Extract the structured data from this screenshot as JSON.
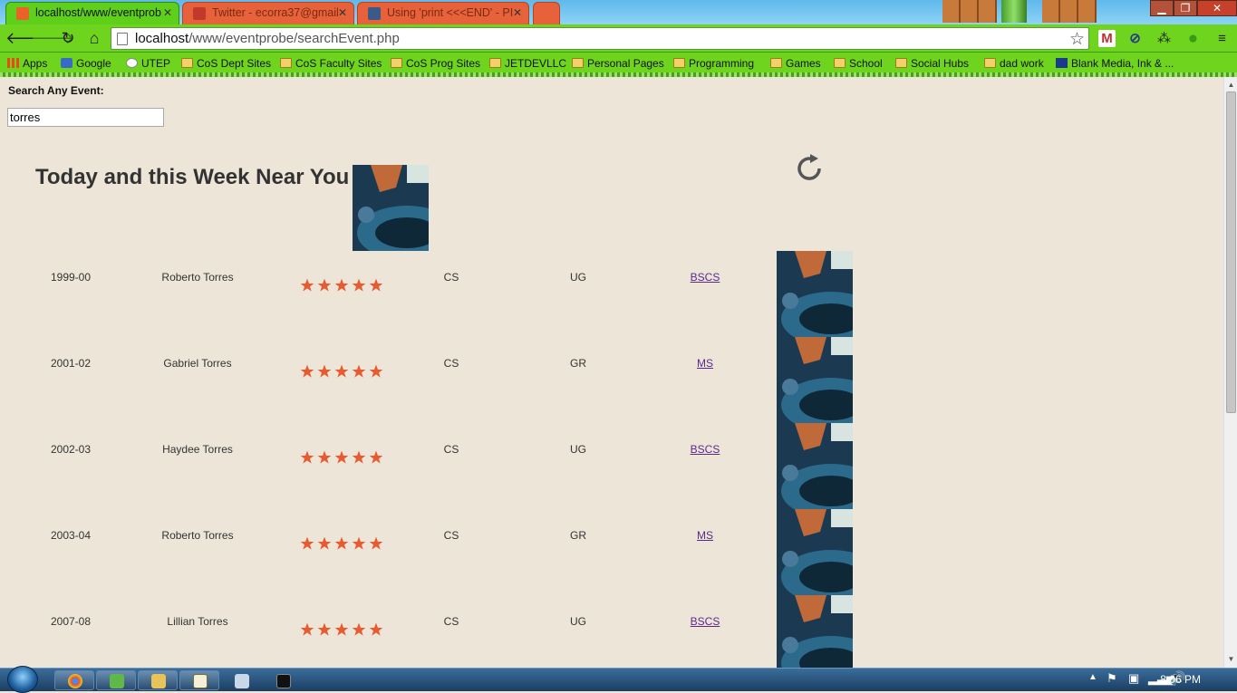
{
  "browser": {
    "tabs": [
      {
        "title": "localhost/www/eventprob",
        "active": true
      },
      {
        "title": "Twitter - ecorra37@gmail",
        "active": false
      },
      {
        "title": "Using 'print <<<END' - PI",
        "active": false
      }
    ],
    "address": {
      "host": "localhost",
      "path": "/www/eventprobe/searchEvent.php"
    },
    "bookmarks": [
      {
        "label": "Apps",
        "icon": "apps-grid-icon"
      },
      {
        "label": "Google",
        "icon": "google-icon"
      },
      {
        "label": "UTEP",
        "icon": "utep-icon"
      },
      {
        "label": "CoS Dept Sites",
        "icon": "folder-icon"
      },
      {
        "label": "CoS Faculty Sites",
        "icon": "folder-icon"
      },
      {
        "label": "CoS Prog Sites",
        "icon": "folder-icon"
      },
      {
        "label": "JETDEVLLC",
        "icon": "folder-icon"
      },
      {
        "label": "Personal Pages",
        "icon": "folder-icon"
      },
      {
        "label": "Programming",
        "icon": "folder-icon"
      },
      {
        "label": "Games",
        "icon": "folder-icon"
      },
      {
        "label": "School",
        "icon": "folder-icon"
      },
      {
        "label": "Social Hubs",
        "icon": "folder-icon"
      },
      {
        "label": "dad work",
        "icon": "folder-icon"
      },
      {
        "label": "Blank Media, Ink & ...",
        "icon": "blank-media-icon"
      }
    ]
  },
  "search": {
    "label": "Search Any Event:",
    "value": "torres"
  },
  "section": {
    "title": "Today and this Week Near You"
  },
  "events": [
    {
      "year": "1999-00",
      "name": "Roberto Torres",
      "rating": 5,
      "dept": "CS",
      "level": "UG",
      "degree": "BSCS"
    },
    {
      "year": "2001-02",
      "name": "Gabriel Torres",
      "rating": 5,
      "dept": "CS",
      "level": "GR",
      "degree": "MS"
    },
    {
      "year": "2002-03",
      "name": "Haydee Torres",
      "rating": 5,
      "dept": "CS",
      "level": "UG",
      "degree": "BSCS"
    },
    {
      "year": "2003-04",
      "name": "Roberto Torres",
      "rating": 5,
      "dept": "CS",
      "level": "GR",
      "degree": "MS"
    },
    {
      "year": "2007-08",
      "name": "Lillian Torres",
      "rating": 5,
      "dept": "CS",
      "level": "UG",
      "degree": "BSCS"
    }
  ],
  "taskbar": {
    "time": "8:06 PM"
  },
  "colors": {
    "star": "#e85a30",
    "link": "#5a2a8a",
    "page_bg": "#ece5d8",
    "chrome_green": "#6fd41e"
  }
}
